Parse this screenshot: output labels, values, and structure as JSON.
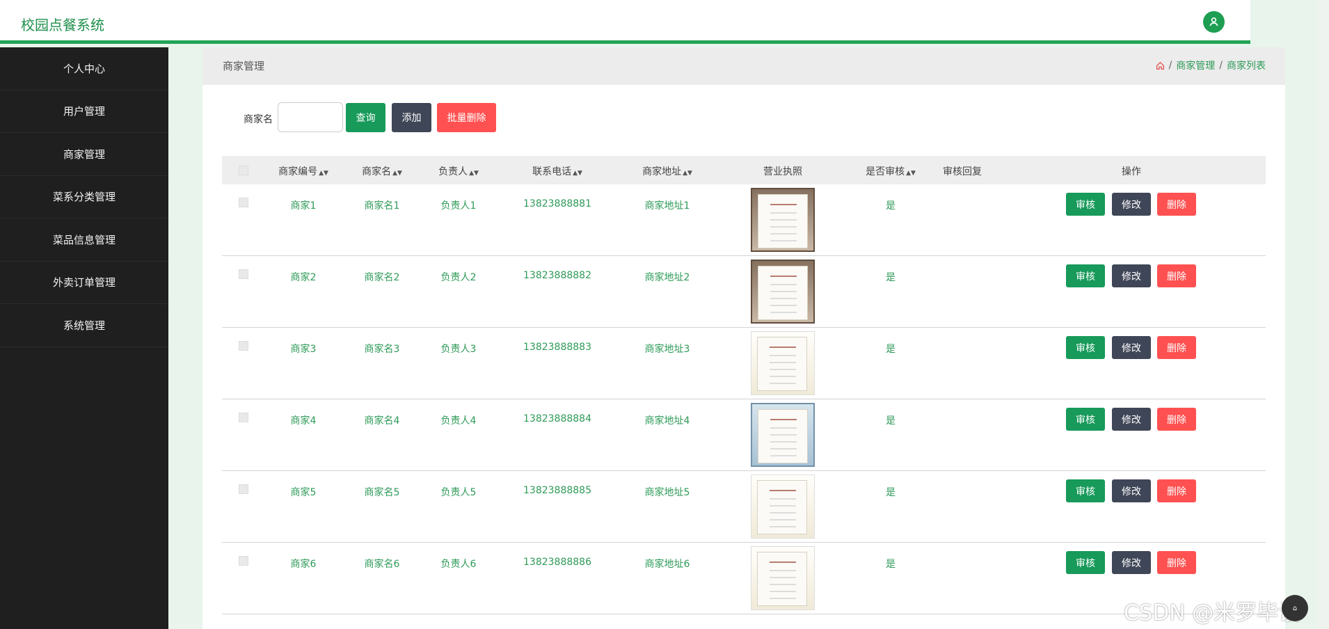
{
  "app": {
    "title": "校园点餐系统"
  },
  "sidebar": {
    "items": [
      {
        "label": "个人中心"
      },
      {
        "label": "用户管理"
      },
      {
        "label": "商家管理"
      },
      {
        "label": "菜系分类管理"
      },
      {
        "label": "菜品信息管理"
      },
      {
        "label": "外卖订单管理"
      },
      {
        "label": "系统管理"
      }
    ]
  },
  "header": {
    "page_title": "商家管理",
    "breadcrumb": [
      "商家管理",
      "商家列表"
    ]
  },
  "search": {
    "label": "商家名",
    "value": "",
    "query": "查询",
    "add": "添加",
    "batch_delete": "批量删除"
  },
  "table": {
    "headers": [
      "商家编号",
      "商家名",
      "负责人",
      "联系电话",
      "商家地址",
      "营业执照",
      "是否审核",
      "审核回复",
      "操作"
    ],
    "sortable": [
      "商家编号",
      "商家名",
      "负责人",
      "联系电话",
      "商家地址",
      "是否审核"
    ],
    "actions": {
      "approve": "审核",
      "edit": "修改",
      "delete": "删除"
    },
    "rows": [
      {
        "id": "商家1",
        "name": "商家名1",
        "owner": "负责人1",
        "phone": "13823888881",
        "address": "商家地址1",
        "audited": "是",
        "reply": "",
        "license_style": "dark"
      },
      {
        "id": "商家2",
        "name": "商家名2",
        "owner": "负责人2",
        "phone": "13823888882",
        "address": "商家地址2",
        "audited": "是",
        "reply": "",
        "license_style": "dark"
      },
      {
        "id": "商家3",
        "name": "商家名3",
        "owner": "负责人3",
        "phone": "13823888883",
        "address": "商家地址3",
        "audited": "是",
        "reply": "",
        "license_style": "light"
      },
      {
        "id": "商家4",
        "name": "商家名4",
        "owner": "负责人4",
        "phone": "13823888884",
        "address": "商家地址4",
        "audited": "是",
        "reply": "",
        "license_style": "blue"
      },
      {
        "id": "商家5",
        "name": "商家名5",
        "owner": "负责人5",
        "phone": "13823888885",
        "address": "商家地址5",
        "audited": "是",
        "reply": "",
        "license_style": "light"
      },
      {
        "id": "商家6",
        "name": "商家名6",
        "owner": "负责人6",
        "phone": "13823888886",
        "address": "商家地址6",
        "audited": "是",
        "reply": "",
        "license_style": "light"
      }
    ]
  },
  "watermark": "CSDN @米罗毕设",
  "colors": {
    "accent": "#21a455",
    "sidebar": "#1f1f1f",
    "danger": "#ff5151"
  }
}
